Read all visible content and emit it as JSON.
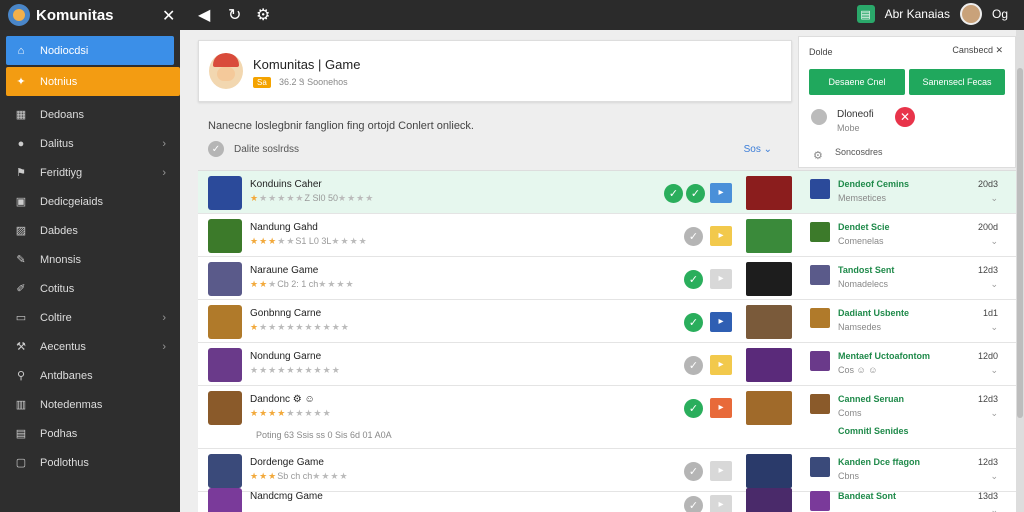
{
  "app": {
    "title": "Komunitas"
  },
  "topbar": {
    "user_name": "Abr Kanaias",
    "user_extra": "Og"
  },
  "sidebar": {
    "items": [
      {
        "label": "Nodiocdsi",
        "icon": "home-icon",
        "chevron": false,
        "state": "active-blue"
      },
      {
        "label": "Notnius",
        "icon": "paw-icon",
        "chevron": false,
        "state": "active-orange"
      },
      {
        "label": "Dedoans",
        "icon": "grid-icon",
        "chevron": false
      },
      {
        "label": "Dalitus",
        "icon": "circle-icon",
        "chevron": true
      },
      {
        "label": "Feridtiyg",
        "icon": "flag-icon",
        "chevron": true
      },
      {
        "label": "Dedicgeiaids",
        "icon": "book-icon",
        "chevron": false
      },
      {
        "label": "Dabdes",
        "icon": "image-icon",
        "chevron": false
      },
      {
        "label": "Mnonsis",
        "icon": "note-icon",
        "chevron": false
      },
      {
        "label": "Cotitus",
        "icon": "pencil-icon",
        "chevron": false
      },
      {
        "label": "Coltire",
        "icon": "card-icon",
        "chevron": true
      },
      {
        "label": "Aecentus",
        "icon": "wrench-icon",
        "chevron": true
      },
      {
        "label": "Antdbanes",
        "icon": "pin-icon",
        "chevron": false
      },
      {
        "label": "Notedenmas",
        "icon": "chart-icon",
        "chevron": false
      },
      {
        "label": "Podhas",
        "icon": "folder-icon",
        "chevron": false
      },
      {
        "label": "Podlothus",
        "icon": "doc-icon",
        "chevron": false
      }
    ]
  },
  "header": {
    "title": "Komunitas | Game",
    "badge": "Sa",
    "meta": "36.2 Ꮥ Soonehos"
  },
  "description": "Nanecne loslegbnir fanglion fing ortojd Conlert onlieck.",
  "filter": {
    "label": "Dalite soslrdss",
    "sort": "Sos ⌄"
  },
  "right_panel": {
    "label": "Dolde",
    "close_label": "Cansbecd ✕",
    "button1": "Desaene Cnel",
    "button2": "Sanensecl Fecas",
    "name": "Dloneofi",
    "sub": "Mobe",
    "settings_label": "Soncosdres"
  },
  "list": [
    {
      "name": "Konduins Caher",
      "stars_on": 1,
      "stars_total": 6,
      "stars_text": "Z Sl0 50",
      "check1": "green",
      "check2": "green",
      "sq_color": "#4a90d9",
      "cover": "#8b1d1d",
      "game_name": "Dendeof Cemins",
      "game_sub": "Memsetices",
      "time": "20d3",
      "thumb": "#2b4a9a",
      "highlight": true
    },
    {
      "name": "Nandung Gahd",
      "stars_on": 3,
      "stars_total": 5,
      "stars_text": "S⁠1 L0 3L",
      "check1": "grey",
      "check2": "",
      "sq_color": "#f2c94c",
      "cover": "#3a8a3a",
      "game_name": "Dendet Scie",
      "game_sub": "Comenelas",
      "time": "200d",
      "thumb": "#3c7a2a",
      "highlight": false
    },
    {
      "name": "Naraune Game",
      "stars_on": 2,
      "stars_total": 3,
      "stars_text": "Cb 2: 1 ch",
      "check1": "green",
      "check2": "",
      "sq_color": "#d8d8d8",
      "cover": "#1d1d1d",
      "game_name": "Tandost Sent",
      "game_sub": "Nomadelecs",
      "time": "12d3",
      "thumb": "#5a5a8a",
      "highlight": false
    },
    {
      "name": "Gonbnng Carne",
      "stars_on": 1,
      "stars_total": 7,
      "stars_text": "",
      "check1": "green",
      "check2": "",
      "sq_color": "#2f5fb3",
      "cover": "#7a5a3a",
      "game_name": "Dadiant Usbente",
      "game_sub": "Namsedes",
      "time": "1d1",
      "thumb": "#b07a2a",
      "highlight": false
    },
    {
      "name": "Nondung Garne",
      "stars_on": 0,
      "stars_total": 6,
      "stars_text": "",
      "check1": "grey",
      "check2": "",
      "sq_color": "#f2c94c",
      "cover": "#5a2a7a",
      "game_name": "Mentaef Uctoafontom",
      "game_sub": "Cos ☺ ☺",
      "time": "12d0",
      "thumb": "#6a3a8a",
      "highlight": false
    },
    {
      "name": "Dandonc ⚙ ☺",
      "stars_on": 4,
      "stars_total": 5,
      "stars_text": "",
      "check1": "green",
      "check2": "",
      "sq_color": "#e86a3a",
      "cover": "#a06a2a",
      "game_name": "Canned Seruan",
      "game_sub": "Coms",
      "extra_text": "Poting 63 Ssis ss 0 Sis 6d 01 A0A",
      "extra_name": "Comnitl Senides",
      "time": "12d3",
      "thumb": "#8a5a2a",
      "highlight": false
    },
    {
      "name": "Dordenge Game",
      "stars_on": 3,
      "stars_total": 3,
      "stars_text": "Sb ch ch",
      "check1": "grey",
      "check2": "",
      "sq_color": "#d8d8d8",
      "cover": "#2a3a6a",
      "game_name": "Kanden Dce ffagon",
      "game_sub": "Cbns",
      "time": "12d3",
      "thumb": "#3a4a7a",
      "highlight": false
    },
    {
      "name": "Nandcmg Game",
      "stars_on": 0,
      "stars_total": 0,
      "stars_text": "",
      "check1": "grey",
      "check2": "",
      "sq_color": "#d8d8d8",
      "cover": "#4a2a6a",
      "game_name": "Bandeat Sont",
      "game_sub": "",
      "time": "13d3",
      "thumb": "#7a3a9a",
      "highlight": false
    }
  ]
}
